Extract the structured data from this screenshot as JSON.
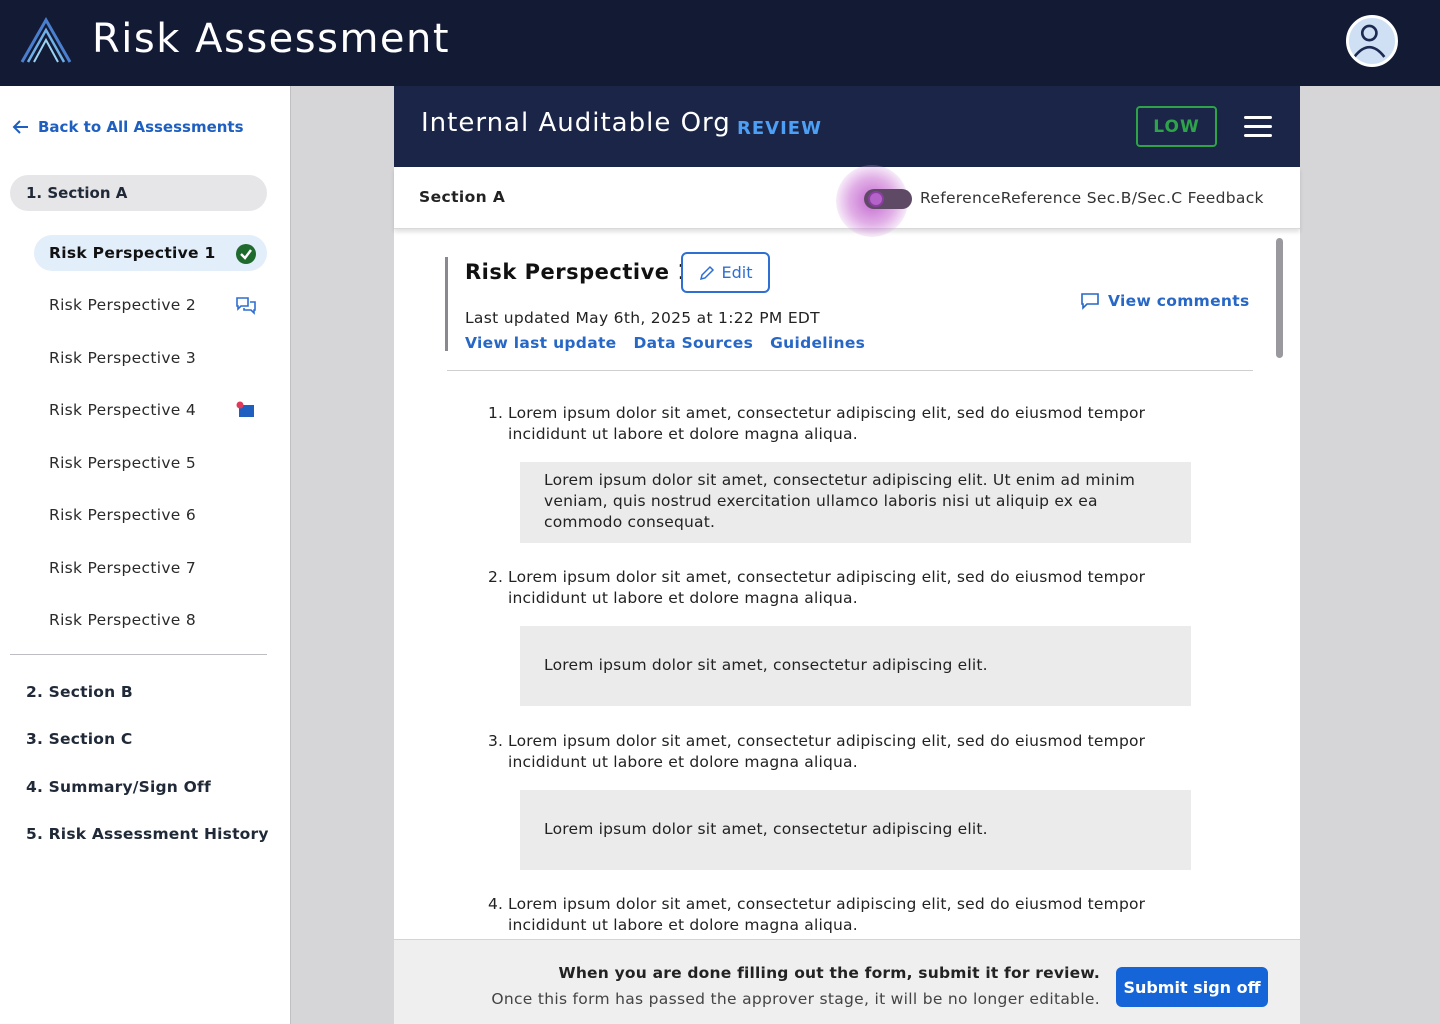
{
  "app": {
    "title": "Risk Assessment"
  },
  "sidebar": {
    "back_label": "Back to All Assessments",
    "section_a": "1. Section A",
    "items": [
      {
        "label": "Risk Perspective 1",
        "icon": "check-circle-icon"
      },
      {
        "label": "Risk Perspective 2",
        "icon": "comments-icon"
      },
      {
        "label": "Risk Perspective 3",
        "icon": ""
      },
      {
        "label": "Risk Perspective 4",
        "icon": "flag-icon"
      },
      {
        "label": "Risk Perspective 5",
        "icon": ""
      },
      {
        "label": "Risk Perspective 6",
        "icon": ""
      },
      {
        "label": "Risk Perspective 7",
        "icon": ""
      },
      {
        "label": "Risk Perspective 8",
        "icon": ""
      }
    ],
    "sections": [
      "2. Section  B",
      "3. Section C",
      "4. Summary/Sign Off",
      "5. Risk Assessment History"
    ]
  },
  "panel": {
    "org_title": "Internal Auditable Org",
    "status_tag": "REVIEW",
    "risk_badge": "LOW",
    "risk_badge_color": "#2ea34a",
    "section_title": "Section A",
    "toggle_label": "ReferenceReference Sec.B/Sec.C Feedback",
    "rp_title": "Risk Perspective 1",
    "edit_label": "Edit",
    "last_updated": "Last updated May 6th, 2025 at 1:22 PM EDT",
    "links": [
      "View last update",
      "Data Sources",
      "Guidelines"
    ],
    "view_comments": "View comments",
    "questions": [
      {
        "num": "1.",
        "text": "Lorem ipsum dolor sit amet, consectetur adipiscing elit, sed do eiusmod tempor incididunt ut labore et dolore magna aliqua.",
        "answer": "Lorem ipsum dolor sit amet, consectetur adipiscing elit. Ut enim ad minim veniam, quis nostrud exercitation ullamco laboris nisi ut aliquip ex ea commodo consequat."
      },
      {
        "num": "2.",
        "text": "Lorem ipsum dolor sit amet, consectetur adipiscing elit, sed do eiusmod tempor incididunt ut labore et dolore magna aliqua.",
        "answer": "Lorem ipsum dolor sit amet, consectetur adipiscing elit."
      },
      {
        "num": "3.",
        "text": "Lorem ipsum dolor sit amet, consectetur adipiscing elit, sed do eiusmod tempor incididunt ut labore et dolore magna aliqua.",
        "answer": "Lorem ipsum dolor sit amet, consectetur adipiscing elit."
      },
      {
        "num": "4.",
        "text": "Lorem ipsum dolor sit amet, consectetur adipiscing elit, sed do eiusmod tempor incididunt ut labore et dolore magna aliqua."
      }
    ],
    "footer": {
      "main": "When you are done filling out the form, submit it for review.",
      "sub": "Once this form has passed the approver stage, it will be no longer editable.",
      "submit_label": "Submit sign off"
    }
  },
  "colors": {
    "header_bg": "#131a33",
    "panel_header_bg": "#1b2547",
    "link": "#2767c6",
    "primary_button": "#1565d8"
  }
}
